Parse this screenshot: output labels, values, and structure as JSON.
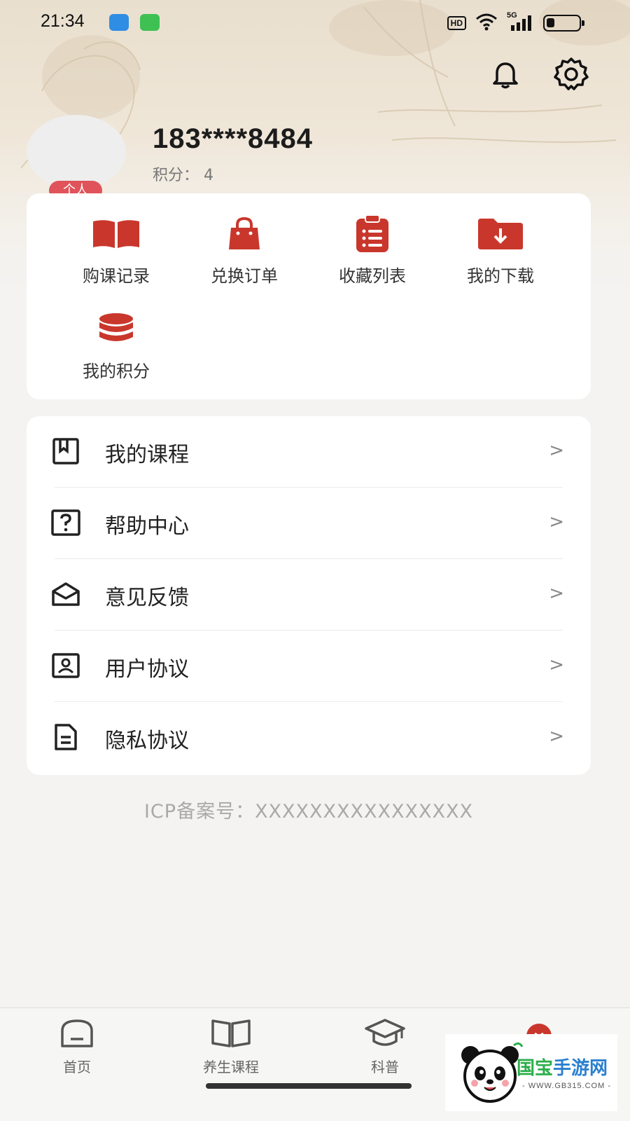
{
  "status_bar": {
    "time": "21:34",
    "network_badge": "HD",
    "signal_label": "5G",
    "battery_level": 0.25
  },
  "header": {
    "icons": [
      "bell-icon",
      "gear-icon"
    ]
  },
  "profile": {
    "badge": "个人",
    "phone": "183****8484",
    "points_text": "积分：  4"
  },
  "quick_actions": [
    {
      "label": "购课记录",
      "icon": "open-book-icon"
    },
    {
      "label": "兑换订单",
      "icon": "shopping-bag-icon"
    },
    {
      "label": "收藏列表",
      "icon": "clipboard-list-icon"
    },
    {
      "label": "我的下载",
      "icon": "folder-download-icon"
    },
    {
      "label": "我的积分",
      "icon": "coin-stack-icon"
    }
  ],
  "menu": [
    {
      "label": "我的课程",
      "icon": "bookmark-book-icon"
    },
    {
      "label": "帮助中心",
      "icon": "question-box-icon"
    },
    {
      "label": "意见反馈",
      "icon": "open-envelope-icon"
    },
    {
      "label": "用户协议",
      "icon": "id-card-icon"
    },
    {
      "label": "隐私协议",
      "icon": "document-icon"
    }
  ],
  "menu_chevron": ">",
  "icp_text": "ICP备案号：XXXXXXXXXXXXXXXX",
  "tabs": [
    {
      "label": "首页",
      "icon": "home-icon"
    },
    {
      "label": "养生课程",
      "icon": "book-icon"
    },
    {
      "label": "科普",
      "icon": "graduation-cap-icon"
    },
    {
      "label": "",
      "icon": "profile-icon"
    }
  ],
  "watermark": {
    "name_hi": "国宝",
    "name_rest": "手游网",
    "url": "- WWW.GB315.COM -"
  },
  "colors": {
    "accent_red": "#c9372c",
    "badge_red": "#e0535a"
  }
}
